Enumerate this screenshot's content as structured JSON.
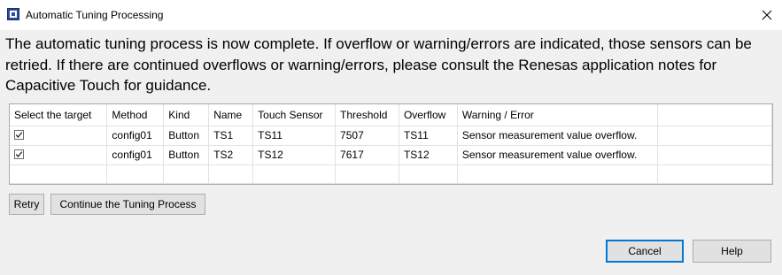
{
  "window": {
    "title": "Automatic Tuning Processing"
  },
  "message": "The automatic tuning process is now complete. If overflow or warning/errors are indicated, those sensors can be retried. If there are continued overflows or warning/errors, please consult the Renesas application notes for Capacitive Touch for guidance.",
  "table": {
    "columns": [
      "Select the target",
      "Method",
      "Kind",
      "Name",
      "Touch Sensor",
      "Threshold",
      "Overflow",
      "Warning / Error"
    ],
    "rows": [
      {
        "selected": true,
        "method": "config01",
        "kind": "Button",
        "name": "TS1",
        "touch_sensor": "TS11",
        "threshold": "7507",
        "overflow": "TS11",
        "warning": "Sensor measurement value overflow."
      },
      {
        "selected": true,
        "method": "config01",
        "kind": "Button",
        "name": "TS2",
        "touch_sensor": "TS12",
        "threshold": "7617",
        "overflow": "TS12",
        "warning": "Sensor measurement value overflow."
      }
    ]
  },
  "buttons": {
    "retry": "Retry",
    "continue": "Continue the Tuning Process",
    "cancel": "Cancel",
    "help": "Help"
  },
  "icons": {
    "app": "renesas-chip-icon",
    "close": "close-icon",
    "checkbox": "checkmark-icon"
  },
  "colors": {
    "accent": "#0078d7",
    "app_icon": "#2a4a9a"
  }
}
